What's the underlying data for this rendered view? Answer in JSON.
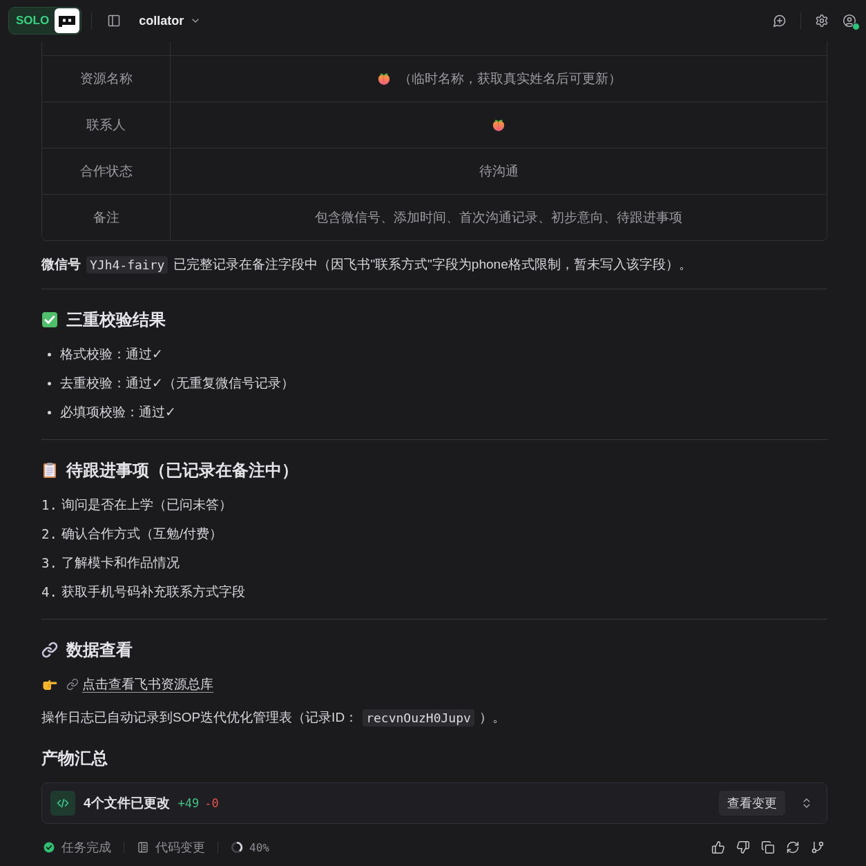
{
  "topbar": {
    "mode_badge": "SOLO",
    "project": "collator",
    "account": {
      "online": true
    }
  },
  "record_table": {
    "rows": [
      {
        "kind": "emoji_text",
        "label": "资源名称",
        "value": "（临时名称，获取真实姓名后可更新）"
      },
      {
        "kind": "emoji",
        "label": "联系人"
      },
      {
        "kind": "text",
        "label": "合作状态",
        "value": "待沟通"
      },
      {
        "kind": "text",
        "label": "备注",
        "value": "包含微信号、添加时间、首次沟通记录、初步意向、待跟进事项"
      }
    ]
  },
  "note": {
    "segments": [
      {
        "kind": "bold",
        "text": "微信号"
      },
      {
        "kind": "code",
        "text": "YJh4-fairy"
      },
      {
        "kind": "text",
        "text": "已完整记录在备注字段中（因飞书\"联系方式\"字段为phone格式限制，暂未写入该字段）。"
      }
    ]
  },
  "sections": [
    {
      "kind": "bullets",
      "title": "三重校验结果",
      "items": [
        {
          "text": "格式校验：通过✓"
        },
        {
          "text": "去重校验：通过✓（无重复微信号记录）"
        },
        {
          "text": "必填项校验：通过✓"
        }
      ]
    },
    {
      "kind": "numbered",
      "title": "待跟进事项（已记录在备注中）",
      "items": [
        {
          "number": "1.",
          "text": "询问是否在上学（已问未答）"
        },
        {
          "number": "2.",
          "text": "确认合作方式（互勉/付费）"
        },
        {
          "number": "3.",
          "text": "了解模卡和作品情况"
        },
        {
          "number": "4.",
          "text": "获取手机号码补充联系方式字段"
        }
      ]
    },
    {
      "kind": "data",
      "title": "数据查看",
      "link": "点击查看飞书资源总库",
      "log": [
        {
          "kind": "text",
          "text": "操作日志已自动记录到SOP迭代优化管理表（记录ID："
        },
        {
          "kind": "code",
          "text": "recvnOuzH0Jupv"
        },
        {
          "kind": "text",
          "text": "）。"
        }
      ]
    }
  ],
  "artifacts": {
    "title": "产物汇总",
    "summary": "4个文件已更改",
    "added": "+49",
    "removed": "-0",
    "button": "查看变更"
  },
  "status_bar": {
    "items": [
      {
        "kind": "done",
        "label": "任务完成"
      },
      {
        "kind": "changes",
        "label": "代码变更"
      },
      {
        "kind": "progress",
        "level": 0.4,
        "reading": "40%"
      }
    ]
  }
}
